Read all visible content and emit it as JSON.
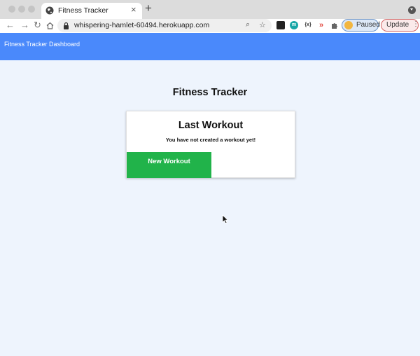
{
  "browser": {
    "tab_title": "Fitness Tracker",
    "tab_close": "×",
    "new_tab": "+",
    "url": "whispering-hamlet-60494.herokuapp.com",
    "back": "←",
    "forward": "→",
    "reload": "↻",
    "search_glyph": "⌕",
    "bookmark_glyph": "☆",
    "extensions": [
      {
        "icon": "extension-box-icon",
        "label": ""
      },
      {
        "icon": "extension-m-icon",
        "label": "m"
      },
      {
        "icon": "extension-braces-icon",
        "label": "{x}"
      },
      {
        "icon": "extension-arrow-icon",
        "label": "»"
      },
      {
        "icon": "puzzle-icon",
        "label": ""
      }
    ],
    "profile_label": "Paused",
    "update_label": "Update",
    "update_menu": "⋮"
  },
  "navbar": {
    "brand": "Fitness Tracker Dashboard"
  },
  "main": {
    "title": "Fitness Tracker",
    "card": {
      "title": "Last Workout",
      "message": "You have not created a workout yet!",
      "button_label": "New Workout"
    }
  },
  "colors": {
    "navbar": "#4a89fb",
    "page_bg": "#eef4fd",
    "button": "#21b34a"
  }
}
